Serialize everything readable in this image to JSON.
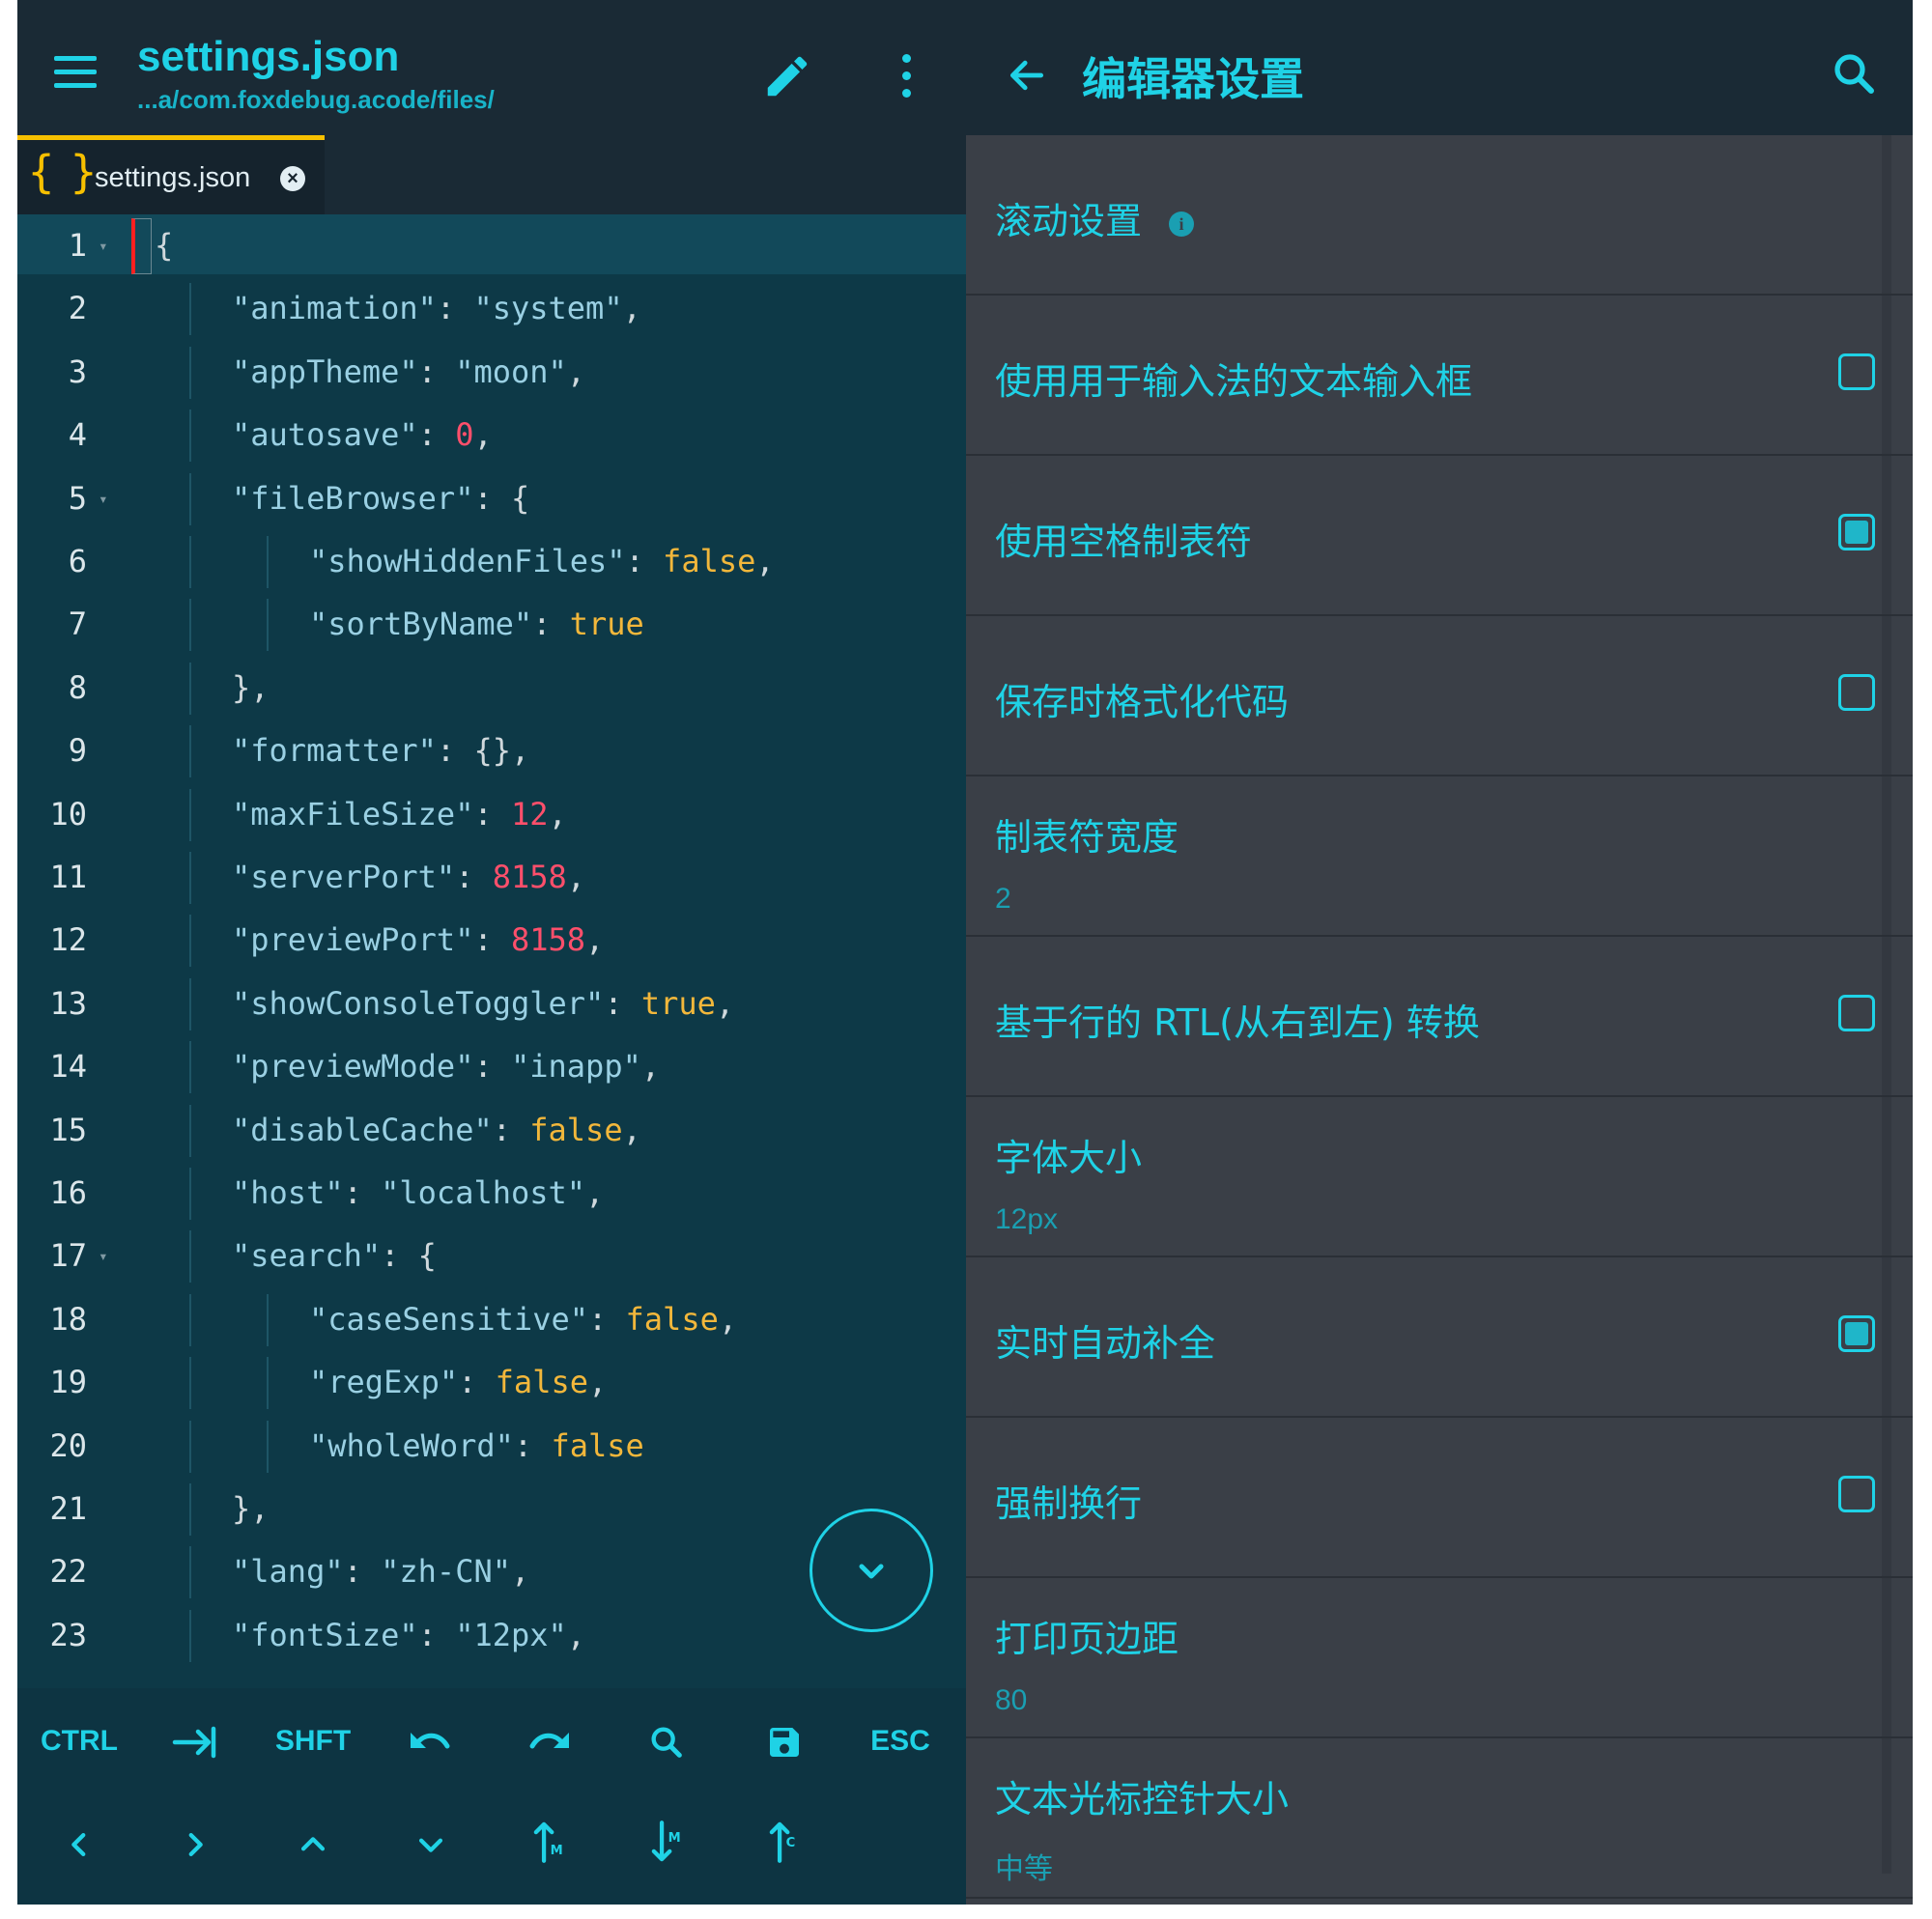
{
  "editor": {
    "title": "settings.json",
    "subtitle": "...a/com.foxdebug.acode/files/",
    "tab": {
      "icon": "{ }",
      "label": "settings.json",
      "close": "×"
    },
    "lines": [
      {
        "n": "1",
        "indent": 0,
        "parts": [
          [
            "p",
            "{"
          ]
        ]
      },
      {
        "n": "2",
        "indent": 1,
        "parts": [
          [
            "k",
            "\"animation\""
          ],
          [
            "p",
            ": "
          ],
          [
            "s",
            "\"system\""
          ],
          [
            "p",
            ","
          ]
        ]
      },
      {
        "n": "3",
        "indent": 1,
        "parts": [
          [
            "k",
            "\"appTheme\""
          ],
          [
            "p",
            ": "
          ],
          [
            "s",
            "\"moon\""
          ],
          [
            "p",
            ","
          ]
        ]
      },
      {
        "n": "4",
        "indent": 1,
        "parts": [
          [
            "k",
            "\"autosave\""
          ],
          [
            "p",
            ": "
          ],
          [
            "n",
            "0"
          ],
          [
            "p",
            ","
          ]
        ]
      },
      {
        "n": "5",
        "indent": 1,
        "parts": [
          [
            "k",
            "\"fileBrowser\""
          ],
          [
            "p",
            ": {"
          ]
        ]
      },
      {
        "n": "6",
        "indent": 2,
        "parts": [
          [
            "k",
            "\"showHiddenFiles\""
          ],
          [
            "p",
            ": "
          ],
          [
            "b",
            "false"
          ],
          [
            "p",
            ","
          ]
        ]
      },
      {
        "n": "7",
        "indent": 2,
        "parts": [
          [
            "k",
            "\"sortByName\""
          ],
          [
            "p",
            ": "
          ],
          [
            "b",
            "true"
          ]
        ]
      },
      {
        "n": "8",
        "indent": 1,
        "parts": [
          [
            "p",
            "},"
          ]
        ]
      },
      {
        "n": "9",
        "indent": 1,
        "parts": [
          [
            "k",
            "\"formatter\""
          ],
          [
            "p",
            ": {},"
          ]
        ]
      },
      {
        "n": "10",
        "indent": 1,
        "parts": [
          [
            "k",
            "\"maxFileSize\""
          ],
          [
            "p",
            ": "
          ],
          [
            "n",
            "12"
          ],
          [
            "p",
            ","
          ]
        ]
      },
      {
        "n": "11",
        "indent": 1,
        "parts": [
          [
            "k",
            "\"serverPort\""
          ],
          [
            "p",
            ": "
          ],
          [
            "n",
            "8158"
          ],
          [
            "p",
            ","
          ]
        ]
      },
      {
        "n": "12",
        "indent": 1,
        "parts": [
          [
            "k",
            "\"previewPort\""
          ],
          [
            "p",
            ": "
          ],
          [
            "n",
            "8158"
          ],
          [
            "p",
            ","
          ]
        ]
      },
      {
        "n": "13",
        "indent": 1,
        "parts": [
          [
            "k",
            "\"showConsoleToggler\""
          ],
          [
            "p",
            ": "
          ],
          [
            "b",
            "true"
          ],
          [
            "p",
            ","
          ]
        ]
      },
      {
        "n": "14",
        "indent": 1,
        "parts": [
          [
            "k",
            "\"previewMode\""
          ],
          [
            "p",
            ": "
          ],
          [
            "s",
            "\"inapp\""
          ],
          [
            "p",
            ","
          ]
        ]
      },
      {
        "n": "15",
        "indent": 1,
        "parts": [
          [
            "k",
            "\"disableCache\""
          ],
          [
            "p",
            ": "
          ],
          [
            "b",
            "false"
          ],
          [
            "p",
            ","
          ]
        ]
      },
      {
        "n": "16",
        "indent": 1,
        "parts": [
          [
            "k",
            "\"host\""
          ],
          [
            "p",
            ": "
          ],
          [
            "s",
            "\"localhost\""
          ],
          [
            "p",
            ","
          ]
        ]
      },
      {
        "n": "17",
        "indent": 1,
        "parts": [
          [
            "k",
            "\"search\""
          ],
          [
            "p",
            ": {"
          ]
        ]
      },
      {
        "n": "18",
        "indent": 2,
        "parts": [
          [
            "k",
            "\"caseSensitive\""
          ],
          [
            "p",
            ": "
          ],
          [
            "b",
            "false"
          ],
          [
            "p",
            ","
          ]
        ]
      },
      {
        "n": "19",
        "indent": 2,
        "parts": [
          [
            "k",
            "\"regExp\""
          ],
          [
            "p",
            ": "
          ],
          [
            "b",
            "false"
          ],
          [
            "p",
            ","
          ]
        ]
      },
      {
        "n": "20",
        "indent": 2,
        "parts": [
          [
            "k",
            "\"wholeWord\""
          ],
          [
            "p",
            ": "
          ],
          [
            "b",
            "false"
          ]
        ]
      },
      {
        "n": "21",
        "indent": 1,
        "parts": [
          [
            "p",
            "},"
          ]
        ]
      },
      {
        "n": "22",
        "indent": 1,
        "parts": [
          [
            "k",
            "\"lang\""
          ],
          [
            "p",
            ": "
          ],
          [
            "s",
            "\"zh-CN\""
          ],
          [
            "p",
            ","
          ]
        ]
      },
      {
        "n": "23",
        "indent": 1,
        "parts": [
          [
            "k",
            "\"fontSize\""
          ],
          [
            "p",
            ": "
          ],
          [
            "s",
            "\"12px\""
          ],
          [
            "p",
            ","
          ]
        ]
      }
    ],
    "fold_lines": [
      "1",
      "5",
      "17"
    ],
    "keys_row1": [
      "CTRL",
      "tab-icon",
      "SHFT",
      "undo-icon",
      "redo-icon",
      "search-icon",
      "save-icon",
      "ESC"
    ],
    "keys_row2": [
      "left-icon",
      "right-icon",
      "up-icon",
      "down-icon",
      "move-line-up-icon",
      "move-line-down-icon",
      "copy-line-up-icon"
    ],
    "colors": {
      "accent": "#1fd2e6",
      "tab_accent": "#f7c000",
      "editor_bg": "#0d3947",
      "number": "#ff4f6b",
      "boolean": "#f2b73b"
    }
  },
  "settings": {
    "title": "编辑器设置",
    "items": [
      {
        "label": "滚动设置",
        "info": true
      },
      {
        "label": "使用用于输入法的文本输入框",
        "checkbox": false
      },
      {
        "label": "使用空格制表符",
        "checkbox": true
      },
      {
        "label": "保存时格式化代码",
        "checkbox": false
      },
      {
        "label": "制表符宽度",
        "value": "2"
      },
      {
        "label": "基于行的 RTL(从右到左) 转换",
        "checkbox": false
      },
      {
        "label": "字体大小",
        "value": "12px"
      },
      {
        "label": "实时自动补全",
        "checkbox": true
      },
      {
        "label": "强制换行",
        "checkbox": false
      },
      {
        "label": "打印页边距",
        "value": "80"
      },
      {
        "label": "文本光标控针大小",
        "value": "中等"
      }
    ]
  }
}
